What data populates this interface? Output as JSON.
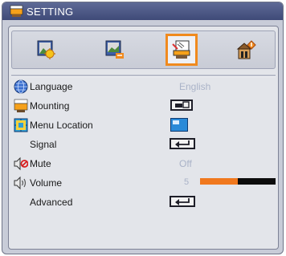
{
  "window": {
    "title": "SETTING",
    "title_icon": "setting-icon"
  },
  "tabs": [
    {
      "name": "image-tab",
      "icon": "image-settings-icon",
      "active": false
    },
    {
      "name": "display-tab",
      "icon": "display-settings-icon",
      "active": false
    },
    {
      "name": "setting-tab",
      "icon": "setting-settings-icon",
      "active": true
    },
    {
      "name": "options-tab",
      "icon": "options-settings-icon",
      "active": false
    }
  ],
  "menu": {
    "language": {
      "label": "Language",
      "value": "English",
      "icon": "globe-icon"
    },
    "mounting": {
      "label": "Mounting",
      "icon": "projector-mount-icon",
      "value_icon": "front-desktop-icon"
    },
    "menu_location": {
      "label": "Menu Location",
      "icon": "menu-location-icon",
      "value_icon": "top-left-position-icon"
    },
    "signal": {
      "label": "Signal",
      "value_icon": "enter-icon"
    },
    "mute": {
      "label": "Mute",
      "value": "Off",
      "icon": "mute-speaker-icon"
    },
    "volume": {
      "label": "Volume",
      "value": "5",
      "icon": "speaker-volume-icon",
      "level_fraction": 0.5
    },
    "advanced": {
      "label": "Advanced",
      "value_icon": "enter-icon"
    }
  },
  "colors": {
    "accent": "#f08a1e",
    "titlebar": "#3f4a78",
    "value_text": "#aab3c8"
  }
}
